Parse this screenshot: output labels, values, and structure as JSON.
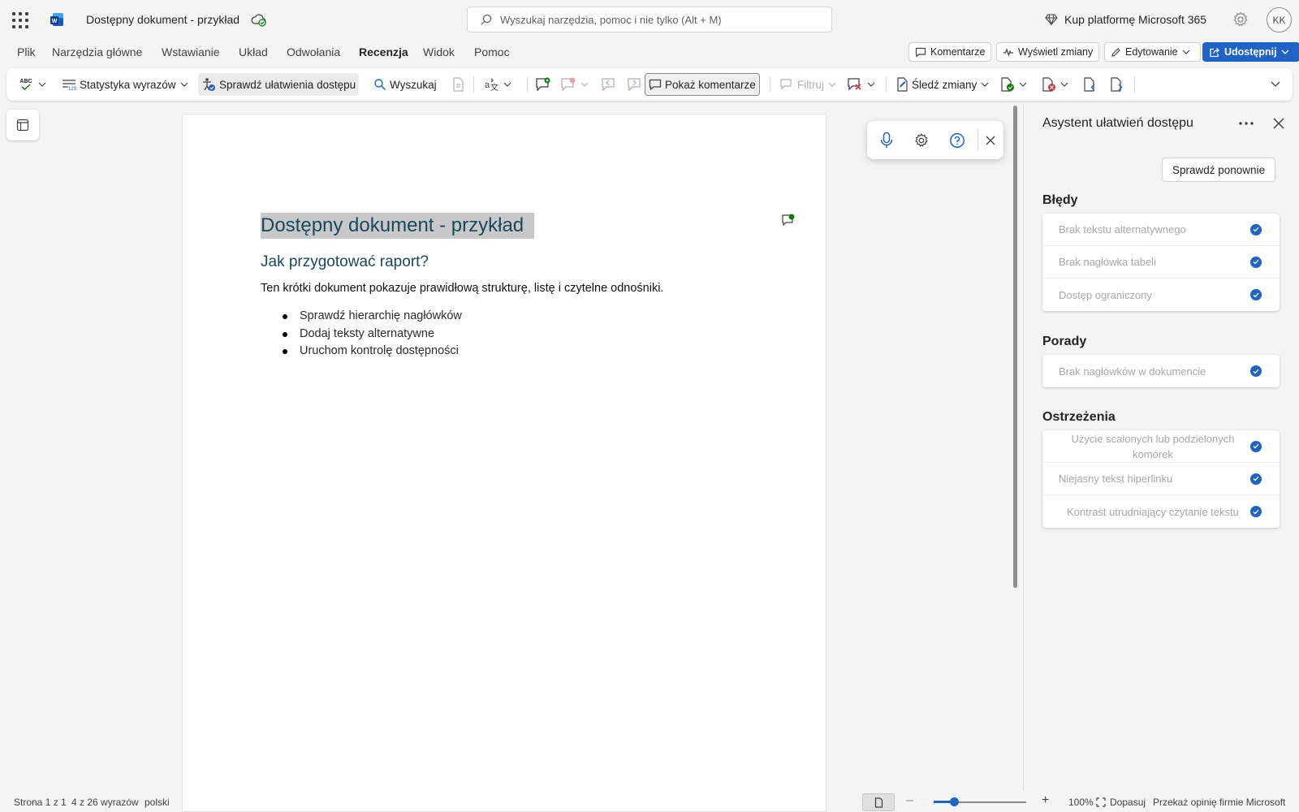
{
  "titlebar": {
    "document_title": "Dostępny dokument - przykład",
    "search_placeholder": "Wyszukaj narzędzia, pomoc i nie tylko (Alt + M)",
    "buy_365": "Kup platformę Microsoft 365",
    "avatar_initials": "KK"
  },
  "menu": {
    "tabs": [
      "Plik",
      "Narzędzia główne",
      "Wstawianie",
      "Układ",
      "Odwołania",
      "Recenzja",
      "Widok",
      "Pomoc"
    ],
    "active_tab": "Recenzja",
    "comments_btn": "Komentarze",
    "show_changes_btn": "Wyświetl zmiany",
    "editing_btn": "Edytowanie",
    "share_btn": "Udostępnij"
  },
  "ribbon": {
    "spelling_icon_text": "ABC",
    "word_count": "Statystyka wyrazów",
    "check_accessibility": "Sprawdź ułatwienia dostępu",
    "search": "Wyszukaj",
    "show_comments": "Pokaż komentarze",
    "filter": "Filtruj",
    "track_changes": "Śledź zmiany"
  },
  "document": {
    "heading1": "Dostępny dokument - przykład",
    "heading2": "Jak przygotować raport?",
    "paragraph": "Ten krótki dokument pokazuje prawidłową strukturę, listę i czytelne odnośniki.",
    "list": [
      "Sprawdź hierarchię nagłówków",
      "Dodaj teksty alternatywne",
      "Uruchom kontrolę dostępności"
    ]
  },
  "pane": {
    "title": "Asystent ułatwień dostępu",
    "recheck": "Sprawdź ponownie",
    "errors": {
      "heading": "Błędy",
      "items": [
        "Brak tekstu alternatywnego",
        "Brak nagłówka tabeli",
        "Dostęp ograniczony"
      ]
    },
    "tips": {
      "heading": "Porady",
      "items": [
        "Brak nagłówków w dokumencie"
      ]
    },
    "warnings": {
      "heading": "Ostrzeżenia",
      "items": [
        "Użycie scalonych lub podzielonych komórek",
        "Niejasny tekst hiperlinku",
        "Kontrast utrudniający czytanie tekstu"
      ]
    }
  },
  "status": {
    "page": "Strona 1 z 1",
    "words": "4 z 26 wyrazów",
    "language": "polski",
    "zoom": "100%",
    "fit": "Dopasuj",
    "feedback": "Przekaż opinię firmie Microsoft"
  },
  "colors": {
    "accent": "#1f64c4",
    "heading": "#17485d",
    "selection": "#c8c8c8"
  }
}
